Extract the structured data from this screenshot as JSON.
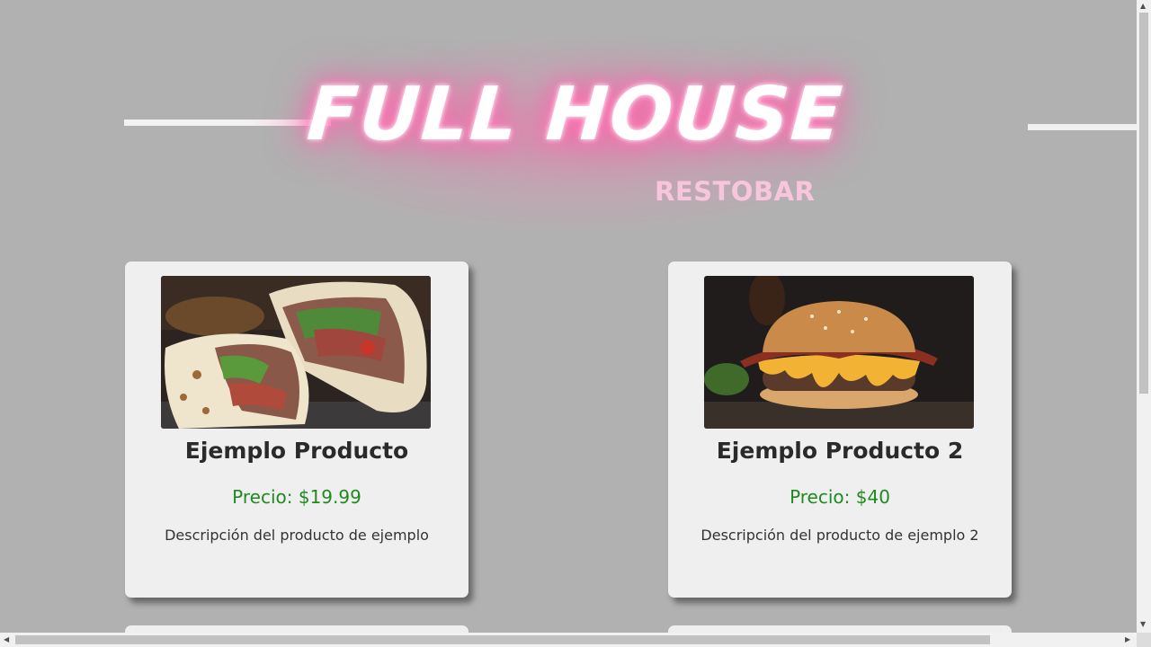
{
  "brand": {
    "title": "FULL HOUSE",
    "subtitle": "RESTOBAR",
    "glow_color": "#ff5fa8"
  },
  "products": [
    {
      "name": "Ejemplo Producto",
      "price": "Precio: $19.99",
      "description": "Descripción del producto de ejemplo",
      "image_icon": "wrap-food-image"
    },
    {
      "name": "Ejemplo Producto 2",
      "price": "Precio: $40",
      "description": "Descripción del producto de ejemplo 2",
      "image_icon": "burger-food-image"
    }
  ],
  "colors": {
    "page_background": "#b1b1b1",
    "card_background": "#efefef",
    "price_color": "#1f8a1f"
  },
  "scrollbars": {
    "up_arrow": "▲",
    "down_arrow": "▼",
    "left_arrow": "◀",
    "right_arrow": "▶"
  }
}
